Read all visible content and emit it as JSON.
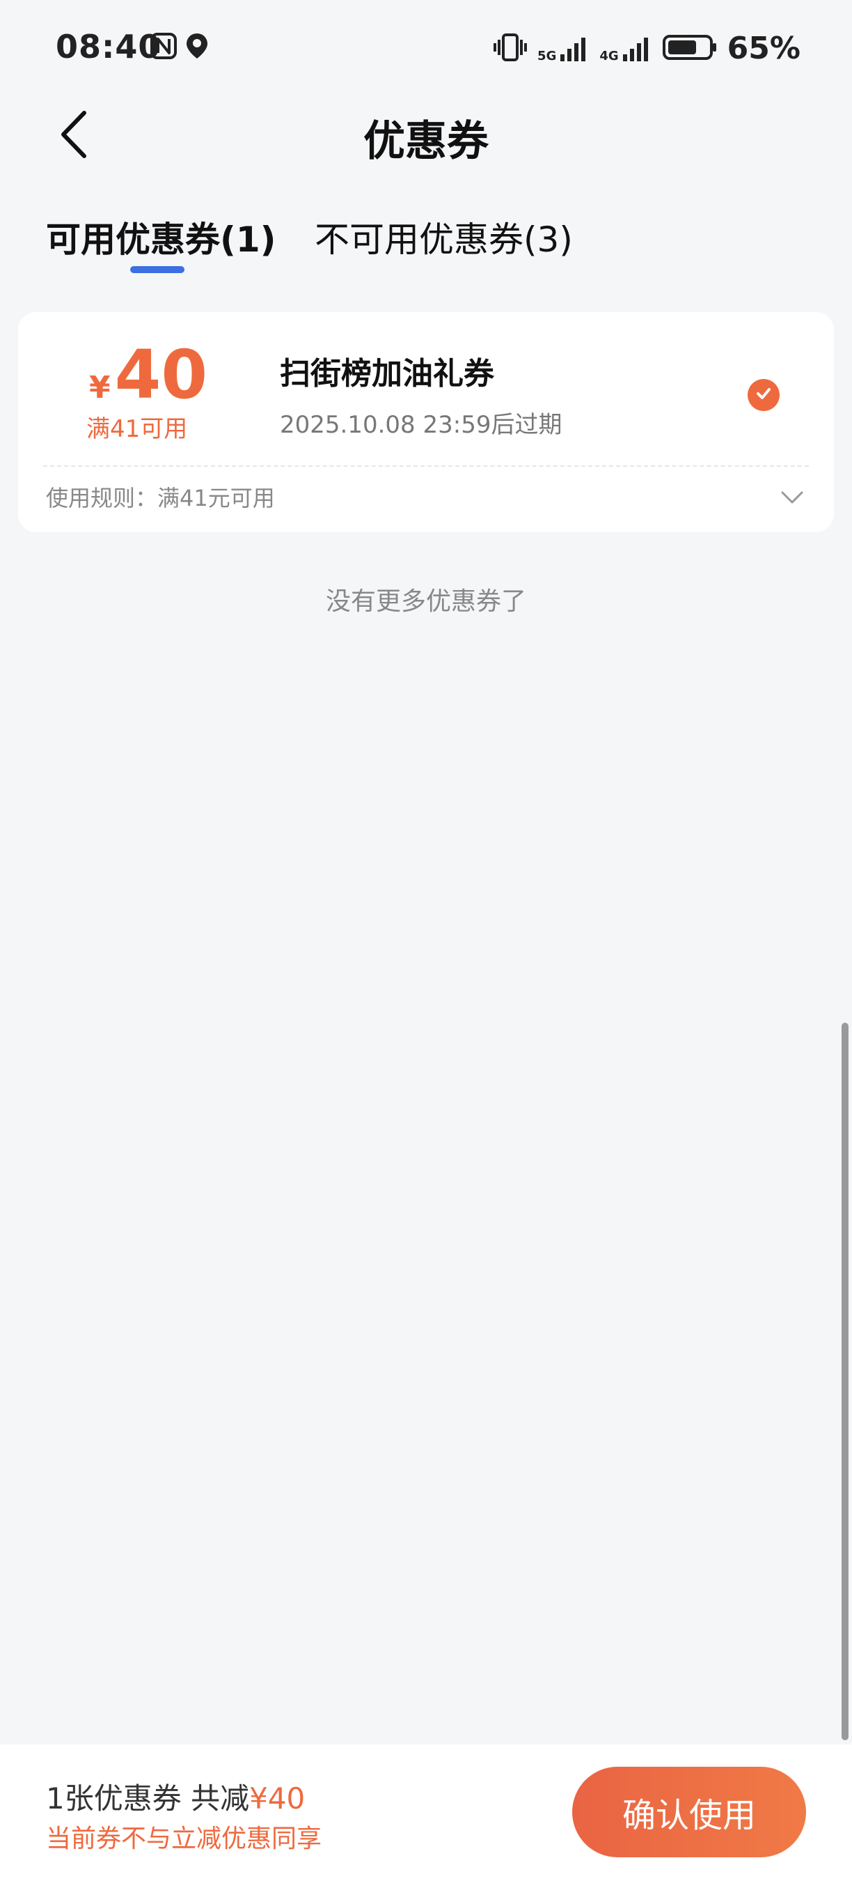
{
  "status_bar": {
    "time": "08:40",
    "battery_text": "65%",
    "net1": "5G",
    "net2": "4G",
    "icons": [
      "nfc-icon",
      "location-icon",
      "vibrate-icon",
      "signal-5g-icon",
      "signal-4g-icon",
      "battery-icon"
    ]
  },
  "header": {
    "title": "优惠券",
    "back_icon": "chevron-left-icon"
  },
  "tabs": [
    {
      "label": "可用优惠券(1)",
      "active": true
    },
    {
      "label": "不可用优惠券(3)",
      "active": false
    }
  ],
  "coupon": {
    "currency": "¥",
    "value": "40",
    "threshold": "满41可用",
    "name": "扫街榜加油礼券",
    "expire": "2025.10.08 23:59后过期",
    "rule": "使用规则：满41元可用",
    "selected": true
  },
  "list_end_text": "没有更多优惠券了",
  "bottom": {
    "summary_prefix": "1张优惠券 共减",
    "summary_amount": "¥40",
    "note": "当前券不与立减优惠同享",
    "confirm_label": "确认使用"
  },
  "colors": {
    "accent": "#ee6a3e",
    "tab_indicator": "#3b6fe2",
    "background": "#f5f6f8"
  }
}
